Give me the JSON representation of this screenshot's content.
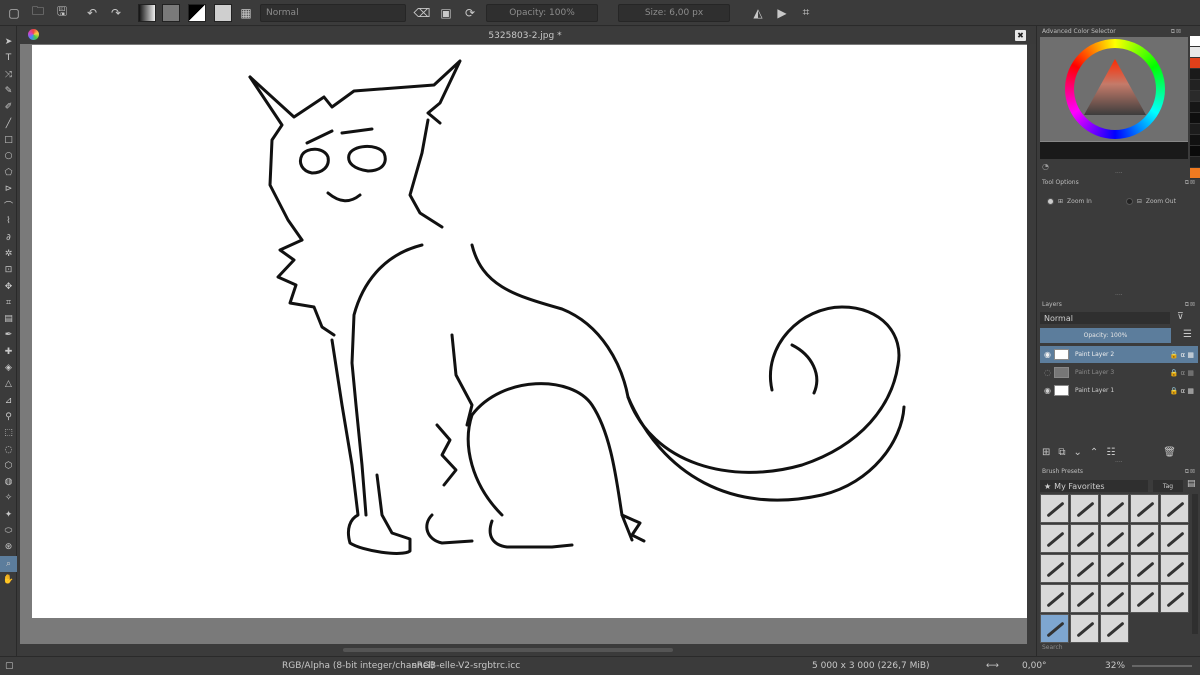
{
  "toolbar": {
    "blend_mode": "Normal",
    "opacity": "Opacity: 100%",
    "size": "Size: 6,00 px",
    "icons": [
      "new-document-icon",
      "open-icon",
      "save-icon",
      "undo-icon",
      "redo-icon",
      "gradient-icon",
      "pattern-icon",
      "color-swap-icon",
      "brush-preset-icon",
      "grid-icon"
    ]
  },
  "document": {
    "title": "5325803-2.jpg *",
    "close_icon": "✖"
  },
  "tools": [
    "select-icon",
    "text-icon",
    "transform-icon",
    "pen-icon",
    "brush-icon",
    "line-icon",
    "rect-icon",
    "ellipse-icon",
    "polygon-icon",
    "polyline-icon",
    "bezier-icon",
    "freehand-path-icon",
    "dynamic-brush-icon",
    "multibrush-icon",
    "crop-icon",
    "move-icon",
    "crop-tool-icon",
    "gradient-tool-icon",
    "color-picker-icon",
    "smart-patch-icon",
    "fill-icon",
    "assistant-icon",
    "measure-icon",
    "reference-icon",
    "rect-select-icon",
    "ellipse-select-icon",
    "polygon-select-icon",
    "freehand-select-icon",
    "contiguous-select-icon",
    "similar-select-icon",
    "bezier-select-icon",
    "magnetic-select-icon",
    "zoom-icon",
    "pan-icon"
  ],
  "status": {
    "color_model": "RGB/Alpha (8-bit integer/channel)",
    "profile": "sRGB-elle-V2-srgbtrc.icc",
    "dimensions": "5 000 x 3 000 (226,7 MiB)",
    "rotation": "0,00°",
    "zoom": "32%"
  },
  "dock": {
    "color_selector_title": "Advanced Color Selector",
    "tool_options_title": "Tool Options",
    "zoom_in": "Zoom In",
    "zoom_out": "Zoom Out",
    "layers_title": "Layers",
    "layers_blend": "Normal",
    "layers_opacity": "Opacity:  100%",
    "layers": [
      {
        "name": "Paint Layer 2",
        "selected": true
      },
      {
        "name": "Paint Layer 3",
        "selected": false
      },
      {
        "name": "Paint Layer 1",
        "selected": false
      }
    ],
    "brush_presets_title": "Brush Presets",
    "preset_tag": "My Favorites",
    "tag_button": "Tag",
    "search_placeholder": "Search"
  },
  "history_colors": [
    "#ffffff",
    "#e8e8e8",
    "#e0401a",
    "#1a1a1a",
    "#222222",
    "#2a2a2a",
    "#161616",
    "#0e0e0e",
    "#1c1c1c",
    "#111111",
    "#0a0a0a",
    "#202020",
    "#f07a20"
  ]
}
